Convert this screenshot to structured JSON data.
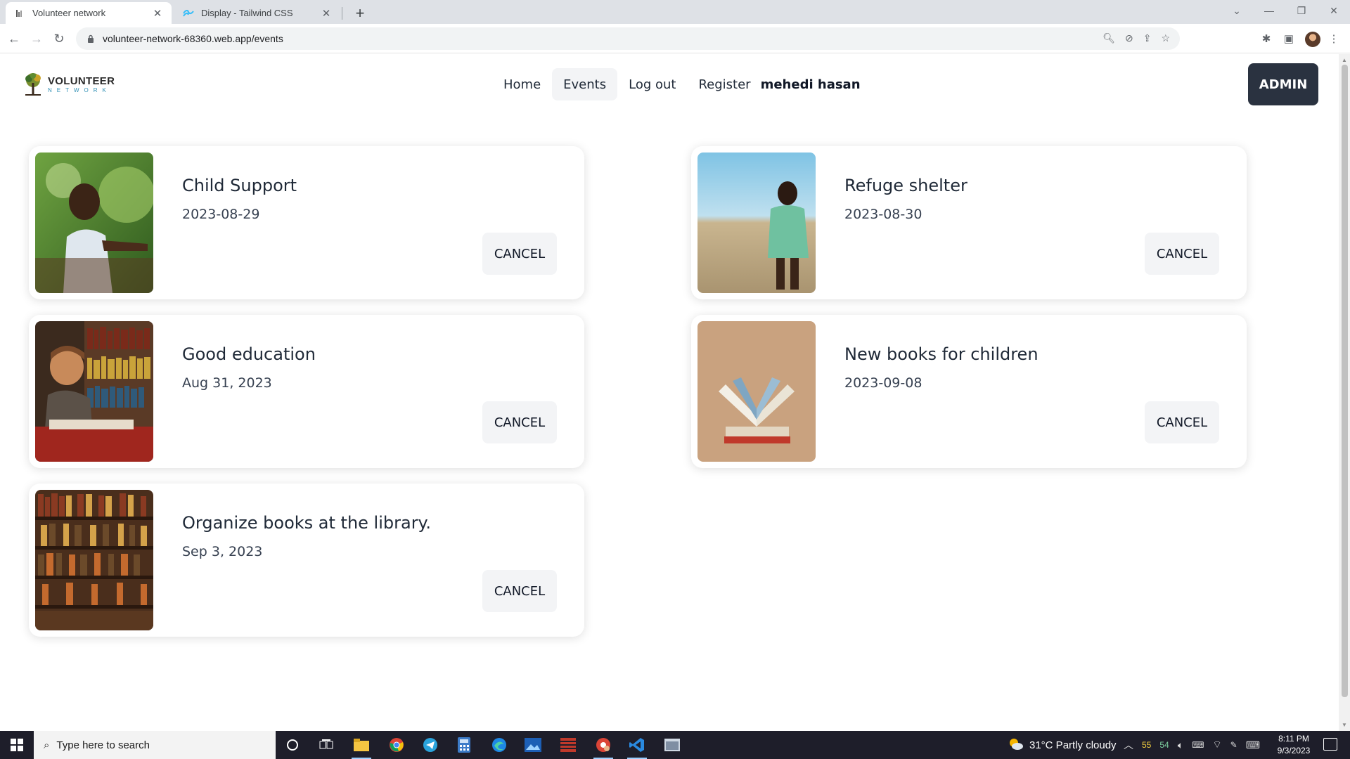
{
  "browser": {
    "tabs": [
      {
        "title": "Volunteer network",
        "active": true
      },
      {
        "title": "Display - Tailwind CSS",
        "active": false
      }
    ],
    "url": "volunteer-network-68360.web.app/events"
  },
  "site": {
    "logo": {
      "word1": "VOLUNTEER",
      "word2": "NETWORK"
    },
    "nav": {
      "home": "Home",
      "events": "Events",
      "logout": "Log out",
      "register": "Register",
      "user": "mehedi hasan"
    },
    "admin_label": "ADMIN"
  },
  "events": [
    {
      "title": "Child Support",
      "date": "2023-08-29",
      "action": "CANCEL"
    },
    {
      "title": "Refuge shelter",
      "date": "2023-08-30",
      "action": "CANCEL"
    },
    {
      "title": "Good education",
      "date": "Aug 31, 2023",
      "action": "CANCEL"
    },
    {
      "title": "New books for children",
      "date": "2023-09-08",
      "action": "CANCEL"
    },
    {
      "title": "Organize books at the library.",
      "date": "Sep 3, 2023",
      "action": "CANCEL"
    }
  ],
  "taskbar": {
    "search_placeholder": "Type here to search",
    "weather": "31°C  Partly cloudy",
    "tray_values": [
      "55",
      "54"
    ],
    "time": "8:11 PM",
    "date": "9/3/2023"
  },
  "colors": {
    "admin_bg": "#2a3240",
    "cancel_bg": "#f3f4f6",
    "active_nav_bg": "#f3f4f6",
    "logo_accent": "#2f8fb4",
    "taskbar_bg": "#1e1e2a"
  }
}
